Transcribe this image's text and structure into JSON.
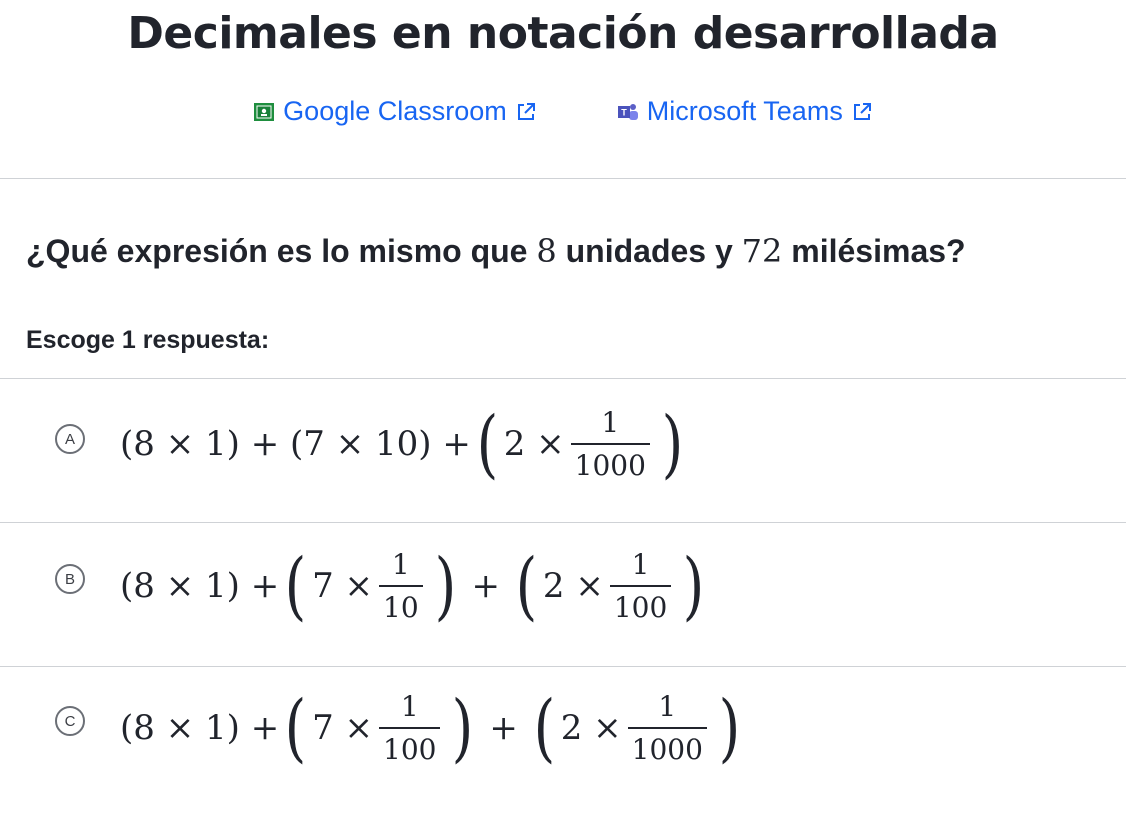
{
  "page": {
    "title": "Decimales en notación desarrollada"
  },
  "share": {
    "google": {
      "label": "Google Classroom",
      "icon": "google-classroom-icon"
    },
    "teams": {
      "label": "Microsoft Teams",
      "icon": "microsoft-teams-icon"
    }
  },
  "question": {
    "before": "¿Qué expresión es lo mismo que ",
    "n1": "8",
    "middle": " unidades y ",
    "n2": "72",
    "after": " milésimas?"
  },
  "prompt": "Escoge 1 respuesta:",
  "choices": [
    {
      "letter": "A",
      "t1": "(8 × 1) + (7 × 10) + ",
      "t2": "2 ×",
      "f1_num": "1",
      "f1_den": "1000"
    },
    {
      "letter": "B",
      "t1": "(8 × 1) + ",
      "t2": "7 ×",
      "f1_num": "1",
      "f1_den": "10",
      "plus": "+",
      "t3": "2 ×",
      "f2_num": "1",
      "f2_den": "100"
    },
    {
      "letter": "C",
      "t1": "(8 × 1) + ",
      "t2": "7 ×",
      "f1_num": "1",
      "f1_den": "100",
      "plus": "+",
      "t3": "2 ×",
      "f2_num": "1",
      "f2_den": "1000"
    }
  ],
  "colors": {
    "link": "#1865f2",
    "text": "#21242c",
    "divider": "#cfd2d6"
  }
}
